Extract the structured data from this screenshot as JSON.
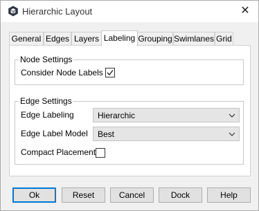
{
  "window": {
    "title": "Hierarchic Layout"
  },
  "tabs": [
    {
      "label": "General"
    },
    {
      "label": "Edges"
    },
    {
      "label": "Layers"
    },
    {
      "label": "Labeling",
      "active": true
    },
    {
      "label": "Grouping"
    },
    {
      "label": "Swimlanes"
    },
    {
      "label": "Grid"
    }
  ],
  "node_settings": {
    "title": "Node Settings",
    "consider_node_labels": {
      "label": "Consider Node Labels",
      "checked": true
    }
  },
  "edge_settings": {
    "title": "Edge Settings",
    "edge_labeling": {
      "label": "Edge Labeling",
      "value": "Hierarchic"
    },
    "edge_label_model": {
      "label": "Edge Label Model",
      "value": "Best"
    },
    "compact_placement": {
      "label": "Compact Placement",
      "checked": false
    }
  },
  "buttons": {
    "ok": "Ok",
    "reset": "Reset",
    "cancel": "Cancel",
    "dock": "Dock",
    "help": "Help"
  },
  "colors": {
    "accent": "#0078d7",
    "panel": "#ffffff",
    "background": "#f0f0f0"
  }
}
